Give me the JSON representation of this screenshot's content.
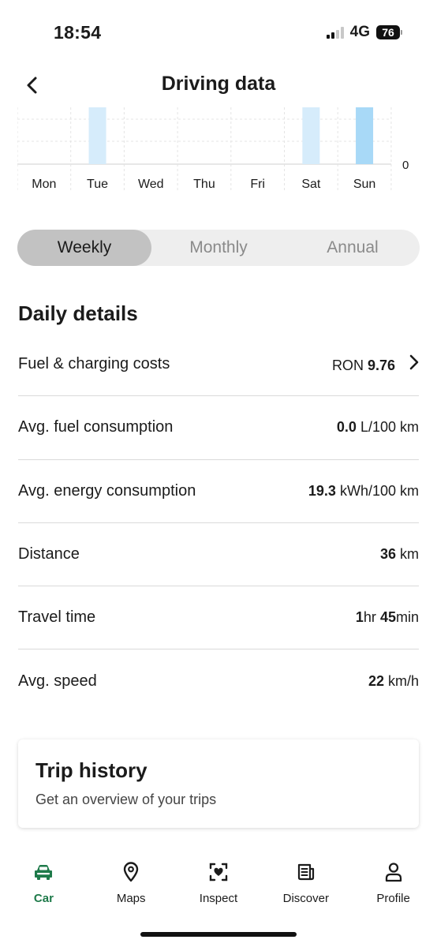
{
  "status_bar": {
    "time": "18:54",
    "network": "4G",
    "battery": "76"
  },
  "header": {
    "title": "Driving data",
    "back_icon": "chevron-left-icon"
  },
  "chart_data": {
    "type": "bar",
    "categories": [
      "Mon",
      "Tue",
      "Wed",
      "Thu",
      "Fri",
      "Sat",
      "Sun"
    ],
    "values": [
      0,
      1,
      0,
      0,
      0,
      1,
      1
    ],
    "highlight_index": 6,
    "y_tick_label": "0",
    "bar_color": "#d6ecfb",
    "highlight_color": "#a8d9f7",
    "grid": true
  },
  "period_tabs": {
    "weekly": "Weekly",
    "monthly": "Monthly",
    "annual": "Annual",
    "selected": "Weekly"
  },
  "daily_details": {
    "title": "Daily details",
    "fuel_costs": {
      "label": "Fuel & charging costs",
      "unit": "RON",
      "value": "9.76"
    },
    "avg_fuel": {
      "label": "Avg. fuel consumption",
      "value": "0.0",
      "unit": "L/100 km"
    },
    "avg_energy": {
      "label": "Avg. energy consumption",
      "value": "19.3",
      "unit": "kWh/100 km"
    },
    "distance": {
      "label": "Distance",
      "value": "36",
      "unit": "km"
    },
    "travel_time": {
      "label": "Travel time",
      "hours": "1",
      "hours_unit": "hr",
      "minutes": "45",
      "minutes_unit": "min"
    },
    "avg_speed": {
      "label": "Avg. speed",
      "value": "22",
      "unit": "km/h"
    }
  },
  "trip_history": {
    "title": "Trip history",
    "subtitle": "Get an overview of your trips"
  },
  "tab_bar": {
    "car": "Car",
    "maps": "Maps",
    "inspect": "Inspect",
    "discover": "Discover",
    "profile": "Profile",
    "active": "Car"
  },
  "colors": {
    "accent": "#1e7a4a",
    "segment_active": "#c2c2c2",
    "segment_track": "#eeeeee"
  }
}
